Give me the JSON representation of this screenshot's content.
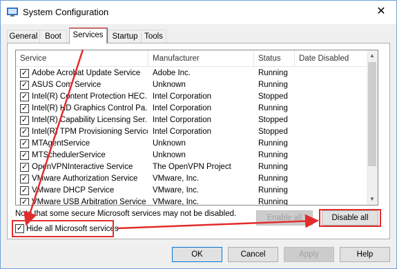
{
  "window": {
    "title": "System Configuration",
    "close_glyph": "✕"
  },
  "tabs": [
    {
      "label": "General"
    },
    {
      "label": "Boot"
    },
    {
      "label": "Services"
    },
    {
      "label": "Startup"
    },
    {
      "label": "Tools"
    }
  ],
  "columns": {
    "service": "Service",
    "manufacturer": "Manufacturer",
    "status": "Status",
    "date_disabled": "Date Disabled"
  },
  "services": [
    {
      "name": "Adobe Acrobat Update Service",
      "manufacturer": "Adobe Inc.",
      "status": "Running",
      "checked": true
    },
    {
      "name": "ASUS Com Service",
      "manufacturer": "Unknown",
      "status": "Running",
      "checked": true
    },
    {
      "name": "Intel(R) Content Protection HEC...",
      "manufacturer": "Intel Corporation",
      "status": "Stopped",
      "checked": true
    },
    {
      "name": "Intel(R) HD Graphics Control Pa...",
      "manufacturer": "Intel Corporation",
      "status": "Running",
      "checked": true
    },
    {
      "name": "Intel(R) Capability Licensing Ser...",
      "manufacturer": "Intel Corporation",
      "status": "Stopped",
      "checked": true
    },
    {
      "name": "Intel(R) TPM Provisioning Service",
      "manufacturer": "Intel Corporation",
      "status": "Stopped",
      "checked": true
    },
    {
      "name": "MTAgentService",
      "manufacturer": "Unknown",
      "status": "Running",
      "checked": true
    },
    {
      "name": "MTSchedulerService",
      "manufacturer": "Unknown",
      "status": "Running",
      "checked": true
    },
    {
      "name": "OpenVPNInteractive Service",
      "manufacturer": "The OpenVPN Project",
      "status": "Running",
      "checked": true
    },
    {
      "name": "VMware Authorization Service",
      "manufacturer": "VMware, Inc.",
      "status": "Running",
      "checked": true
    },
    {
      "name": "VMware DHCP Service",
      "manufacturer": "VMware, Inc.",
      "status": "Running",
      "checked": true
    },
    {
      "name": "VMware USB Arbitration Service",
      "manufacturer": "VMware, Inc.",
      "status": "Running",
      "checked": true
    }
  ],
  "note": "Note that some secure Microsoft services may not be disabled.",
  "hide_ms": {
    "label": "Hide all Microsoft services",
    "checked": true
  },
  "buttons": {
    "enable_all": "Enable all",
    "disable_all": "Disable all",
    "ok": "OK",
    "cancel": "Cancel",
    "apply": "Apply",
    "help": "Help"
  },
  "annotation_color": "#e32b2b",
  "icons": {
    "window": "system-config-icon",
    "check": "✓"
  }
}
